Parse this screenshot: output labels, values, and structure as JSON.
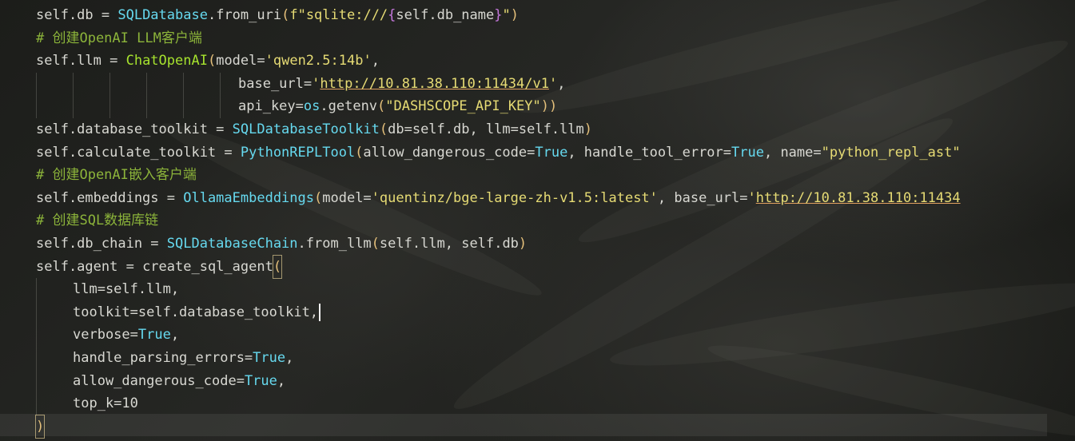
{
  "code_lines": {
    "l1": {
      "a": "self.db = ",
      "b": "SQLDatabase",
      "c": ".",
      "d": "from_uri",
      "e": "(",
      "f": "f\"sqlite:///",
      "g": "{",
      "h": "self.db_name",
      "i": "}",
      "j": "\"",
      "k": ")"
    },
    "l2": {
      "comment": "# 创建OpenAI LLM客户端"
    },
    "l3": {
      "a": "self.llm = ",
      "b": "ChatOpenAI",
      "c": "(",
      "d": "model=",
      "e": "'qwen2.5:14b'",
      "f": ","
    },
    "l4": {
      "a": "base_url=",
      "b": "'",
      "c": "http://10.81.38.110:11434/v1",
      "d": "'",
      "e": ","
    },
    "l5": {
      "a": "api_key=",
      "b": "os",
      "c": ".",
      "d": "getenv",
      "e": "(",
      "f": "\"DASHSCOPE_API_KEY\"",
      "g": "))"
    },
    "l6": {
      "a": "self.database_toolkit = ",
      "b": "SQLDatabaseToolkit",
      "c": "(",
      "d": "db=self.db, llm=self.llm",
      "e": ")"
    },
    "l7": {
      "a": "self.calculate_toolkit = ",
      "b": "PythonREPLTool",
      "c": "(",
      "d": "allow_dangerous_code=",
      "e": "True",
      "f": ", handle_tool_error=",
      "g": "True",
      "h": ", name=",
      "i": "\"python_repl_ast\""
    },
    "l8": {
      "comment": "# 创建OpenAI嵌入客户端"
    },
    "l9": {
      "a": "self.embeddings = ",
      "b": "OllamaEmbeddings",
      "c": "(",
      "d": "model=",
      "e": "'quentinz/bge-large-zh-v1.5:latest'",
      "f": ", base_url=",
      "g": "'",
      "h": "http://10.81.38.110:11434"
    },
    "l10": {
      "comment": "# 创建SQL数据库链"
    },
    "l11": {
      "a": "self.db_chain = ",
      "b": "SQLDatabaseChain",
      "c": ".",
      "d": "from_llm",
      "e": "(",
      "f": "self.llm, self.db",
      "g": ")"
    },
    "l12": {
      "a": "self.agent = ",
      "b": "create_sql_agent",
      "c": "("
    },
    "l13": {
      "a": "llm=self.llm,"
    },
    "l14": {
      "a": "toolkit=self.database_toolkit,"
    },
    "l15": {
      "a": "verbose=",
      "b": "True",
      "c": ","
    },
    "l16": {
      "a": "handle_parsing_errors=",
      "b": "True",
      "c": ","
    },
    "l17": {
      "a": "allow_dangerous_code=",
      "b": "True",
      "c": ","
    },
    "l18": {
      "a": "top_k=",
      "b": "10"
    },
    "l19": {
      "a": ")"
    }
  },
  "colors": {
    "background": "#1e1f1c",
    "class": "#66d9ef",
    "function": "#a6e22e",
    "string": "#e6db74",
    "comment": "#8cb43a",
    "bracket": "#e5c07b",
    "fstring_brace": "#c678dd",
    "text": "#d8d8d2"
  }
}
